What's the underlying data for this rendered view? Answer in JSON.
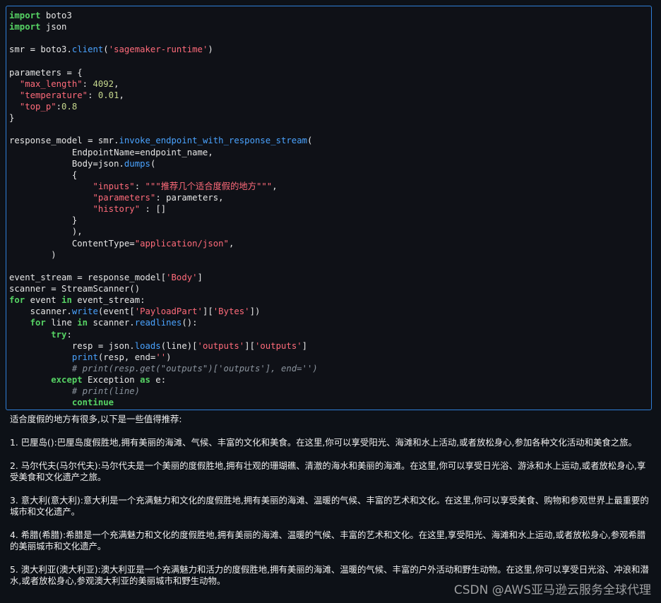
{
  "code_lines": [
    [
      {
        "t": "import",
        "c": "kw"
      },
      {
        "t": " boto3",
        "c": "txt"
      }
    ],
    [
      {
        "t": "import",
        "c": "kw"
      },
      {
        "t": " json",
        "c": "txt"
      }
    ],
    [],
    [
      {
        "t": "smr ",
        "c": "txt"
      },
      {
        "t": "=",
        "c": "op"
      },
      {
        "t": " boto3.",
        "c": "txt"
      },
      {
        "t": "client",
        "c": "fn"
      },
      {
        "t": "(",
        "c": "txt"
      },
      {
        "t": "'sagemaker-runtime'",
        "c": "str"
      },
      {
        "t": ")",
        "c": "txt"
      }
    ],
    [],
    [
      {
        "t": "parameters ",
        "c": "txt"
      },
      {
        "t": "=",
        "c": "op"
      },
      {
        "t": " {",
        "c": "txt"
      }
    ],
    [
      {
        "t": "  ",
        "c": "txt"
      },
      {
        "t": "\"max_length\"",
        "c": "str"
      },
      {
        "t": ": ",
        "c": "txt"
      },
      {
        "t": "4092",
        "c": "num"
      },
      {
        "t": ",",
        "c": "txt"
      }
    ],
    [
      {
        "t": "  ",
        "c": "txt"
      },
      {
        "t": "\"temperature\"",
        "c": "str"
      },
      {
        "t": ": ",
        "c": "txt"
      },
      {
        "t": "0.01",
        "c": "num"
      },
      {
        "t": ",",
        "c": "txt"
      }
    ],
    [
      {
        "t": "  ",
        "c": "txt"
      },
      {
        "t": "\"top_p\"",
        "c": "str"
      },
      {
        "t": ":",
        "c": "txt"
      },
      {
        "t": "0.8",
        "c": "num"
      }
    ],
    [
      {
        "t": "}",
        "c": "txt"
      }
    ],
    [],
    [
      {
        "t": "response_model ",
        "c": "txt"
      },
      {
        "t": "=",
        "c": "op"
      },
      {
        "t": " smr.",
        "c": "txt"
      },
      {
        "t": "invoke_endpoint_with_response_stream",
        "c": "fn"
      },
      {
        "t": "(",
        "c": "txt"
      }
    ],
    [
      {
        "t": "            EndpointName",
        "c": "txt"
      },
      {
        "t": "=",
        "c": "op"
      },
      {
        "t": "endpoint_name,",
        "c": "txt"
      }
    ],
    [
      {
        "t": "            Body",
        "c": "txt"
      },
      {
        "t": "=",
        "c": "op"
      },
      {
        "t": "json.",
        "c": "txt"
      },
      {
        "t": "dumps",
        "c": "fn"
      },
      {
        "t": "(",
        "c": "txt"
      }
    ],
    [
      {
        "t": "            {",
        "c": "txt"
      }
    ],
    [
      {
        "t": "                ",
        "c": "txt"
      },
      {
        "t": "\"inputs\"",
        "c": "str"
      },
      {
        "t": ": ",
        "c": "txt"
      },
      {
        "t": "\"\"\"推荐几个适合度假的地方\"\"\"",
        "c": "str"
      },
      {
        "t": ",",
        "c": "txt"
      }
    ],
    [
      {
        "t": "                ",
        "c": "txt"
      },
      {
        "t": "\"parameters\"",
        "c": "str"
      },
      {
        "t": ": parameters,",
        "c": "txt"
      }
    ],
    [
      {
        "t": "                ",
        "c": "txt"
      },
      {
        "t": "\"history\"",
        "c": "str"
      },
      {
        "t": " : []",
        "c": "txt"
      }
    ],
    [
      {
        "t": "            }",
        "c": "txt"
      }
    ],
    [
      {
        "t": "            ),",
        "c": "txt"
      }
    ],
    [
      {
        "t": "            ContentType",
        "c": "txt"
      },
      {
        "t": "=",
        "c": "op"
      },
      {
        "t": "\"application/json\"",
        "c": "str"
      },
      {
        "t": ",",
        "c": "txt"
      }
    ],
    [
      {
        "t": "        )",
        "c": "txt"
      }
    ],
    [],
    [
      {
        "t": "event_stream ",
        "c": "txt"
      },
      {
        "t": "=",
        "c": "op"
      },
      {
        "t": " response_model[",
        "c": "txt"
      },
      {
        "t": "'Body'",
        "c": "str"
      },
      {
        "t": "]",
        "c": "txt"
      }
    ],
    [
      {
        "t": "scanner ",
        "c": "txt"
      },
      {
        "t": "=",
        "c": "op"
      },
      {
        "t": " StreamScanner()",
        "c": "txt"
      }
    ],
    [
      {
        "t": "for",
        "c": "kw"
      },
      {
        "t": " event ",
        "c": "txt"
      },
      {
        "t": "in",
        "c": "kw"
      },
      {
        "t": " event_stream:",
        "c": "txt"
      }
    ],
    [
      {
        "t": "    scanner.",
        "c": "txt"
      },
      {
        "t": "write",
        "c": "fn"
      },
      {
        "t": "(event[",
        "c": "txt"
      },
      {
        "t": "'PayloadPart'",
        "c": "str"
      },
      {
        "t": "][",
        "c": "txt"
      },
      {
        "t": "'Bytes'",
        "c": "str"
      },
      {
        "t": "])",
        "c": "txt"
      }
    ],
    [
      {
        "t": "    ",
        "c": "txt"
      },
      {
        "t": "for",
        "c": "kw"
      },
      {
        "t": " line ",
        "c": "txt"
      },
      {
        "t": "in",
        "c": "kw"
      },
      {
        "t": " scanner.",
        "c": "txt"
      },
      {
        "t": "readlines",
        "c": "fn"
      },
      {
        "t": "():",
        "c": "txt"
      }
    ],
    [
      {
        "t": "        ",
        "c": "txt"
      },
      {
        "t": "try",
        "c": "kw"
      },
      {
        "t": ":",
        "c": "txt"
      }
    ],
    [
      {
        "t": "            resp ",
        "c": "txt"
      },
      {
        "t": "=",
        "c": "op"
      },
      {
        "t": " json.",
        "c": "txt"
      },
      {
        "t": "loads",
        "c": "fn"
      },
      {
        "t": "(line)[",
        "c": "txt"
      },
      {
        "t": "'outputs'",
        "c": "str"
      },
      {
        "t": "][",
        "c": "txt"
      },
      {
        "t": "'outputs'",
        "c": "str"
      },
      {
        "t": "]",
        "c": "txt"
      }
    ],
    [
      {
        "t": "            ",
        "c": "txt"
      },
      {
        "t": "print",
        "c": "fn"
      },
      {
        "t": "(resp, end",
        "c": "txt"
      },
      {
        "t": "=",
        "c": "op"
      },
      {
        "t": "''",
        "c": "str"
      },
      {
        "t": ")",
        "c": "txt"
      }
    ],
    [
      {
        "t": "            # print(resp.get(\"outputs\")['outputs'], end='')",
        "c": "cmt"
      }
    ],
    [
      {
        "t": "        ",
        "c": "txt"
      },
      {
        "t": "except",
        "c": "kw"
      },
      {
        "t": " Exception ",
        "c": "txt"
      },
      {
        "t": "as",
        "c": "kw"
      },
      {
        "t": " e:",
        "c": "txt"
      }
    ],
    [
      {
        "t": "            # print(line)",
        "c": "cmt"
      }
    ],
    [
      {
        "t": "            ",
        "c": "txt"
      },
      {
        "t": "continue",
        "c": "kw"
      }
    ]
  ],
  "output": {
    "intro": "适合度假的地方有很多,以下是一些值得推荐:",
    "items": [
      "1. 巴厘岛():巴厘岛度假胜地,拥有美丽的海滩、气候、丰富的文化和美食。在这里,你可以享受阳光、海滩和水上活动,或者放松身心,参加各种文化活动和美食之旅。",
      "2. 马尔代夫(马尔代夫):马尔代夫是一个美丽的度假胜地,拥有壮观的珊瑚礁、清澈的海水和美丽的海滩。在这里,你可以享受日光浴、游泳和水上运动,或者放松身心,享受美食和文化遗产之旅。",
      "3. 意大利(意大利):意大利是一个充满魅力和文化的度假胜地,拥有美丽的海滩、温暖的气候、丰富的艺术和文化。在这里,你可以享受美食、购物和参观世界上最重要的城市和文化遗产。",
      "4. 希腊(希腊):希腊是一个充满魅力和文化的度假胜地,拥有美丽的海滩、温暖的气候、丰富的艺术和文化。在这里,享受阳光、海滩和水上运动,或者放松身心,参观希腊的美丽城市和文化遗产。",
      "5. 澳大利亚(澳大利亚):澳大利亚是一个充满魅力和活力的度假胜地,拥有美丽的海滩、温暖的气候、丰富的户外活动和野生动物。在这里,你可以享受日光浴、冲浪和潜水,或者放松身心,参观澳大利亚的美丽城市和野生动物。"
    ]
  },
  "watermark": "CSDN @AWS亚马逊云服务全球代理",
  "colors": {
    "background": "#0d1117",
    "cell_border": "#2f7fd8",
    "keyword": "#56d364",
    "string": "#ff6b7a",
    "number": "#c6d88e",
    "function": "#4aa3ff",
    "comment": "#8b949e",
    "text": "#e6e6e6"
  }
}
